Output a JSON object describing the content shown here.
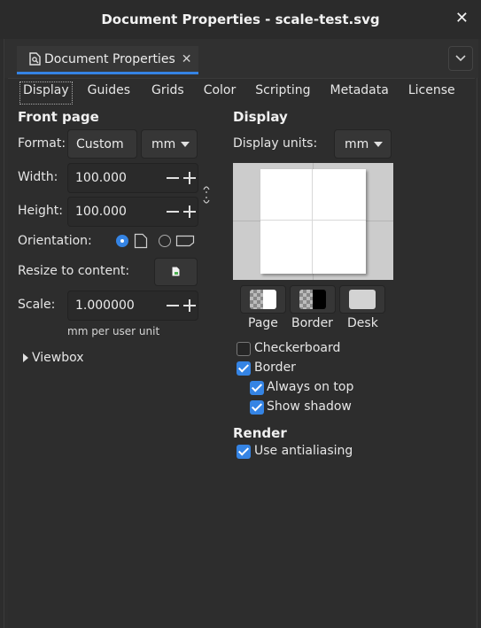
{
  "window": {
    "title": "Document Properties - scale-test.svg"
  },
  "dock": {
    "tab_label": "Document Properties"
  },
  "tabs": [
    "Display",
    "Guides",
    "Grids",
    "Color",
    "Scripting",
    "Metadata",
    "License"
  ],
  "front_page": {
    "title": "Front page",
    "format_label": "Format:",
    "format_value": "Custom",
    "format_unit": "mm",
    "width_label": "Width:",
    "width_value": "100.000",
    "height_label": "Height:",
    "height_value": "100.000",
    "orientation_label": "Orientation:",
    "resize_label": "Resize to content:",
    "scale_label": "Scale:",
    "scale_value": "1.000000",
    "scale_unit_note": "mm per user unit",
    "viewbox_label": "Viewbox"
  },
  "display": {
    "title": "Display",
    "units_label": "Display units:",
    "units_value": "mm",
    "color_buttons": [
      "Page",
      "Border",
      "Desk"
    ],
    "checkboxes": {
      "checkerboard": "Checkerboard",
      "border": "Border",
      "always_on_top": "Always on top",
      "show_shadow": "Show shadow"
    },
    "accent_color": "#3584e4"
  },
  "render": {
    "title": "Render",
    "antialiasing": "Use antialiasing"
  }
}
